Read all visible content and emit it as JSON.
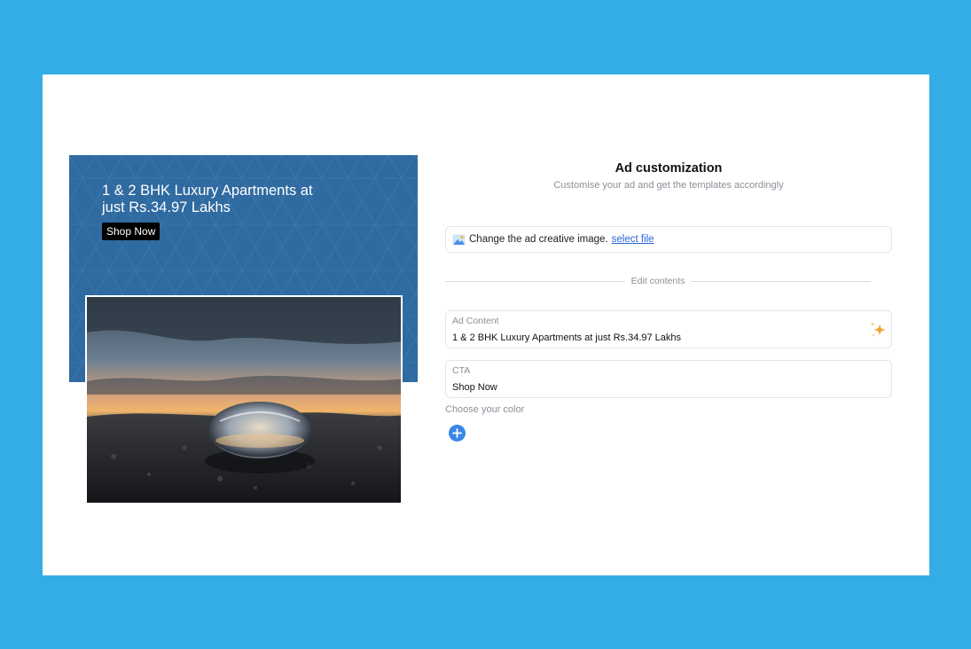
{
  "ad": {
    "headline": "1 & 2 BHK Luxury Apartments at just Rs.34.97 Lakhs",
    "cta_label": "Shop Now",
    "banner_color": "#2f6aa0"
  },
  "panel": {
    "title": "Ad customization",
    "subtitle": "Customise your ad and get the templates accordingly",
    "upload_text": "Change the ad creative image.",
    "upload_link": "select file",
    "divider_label": "Edit contents",
    "content_field": {
      "label": "Ad Content",
      "value": "1 & 2 BHK Luxury Apartments at just Rs.34.97 Lakhs"
    },
    "cta_field": {
      "label": "CTA",
      "value": "Shop Now"
    },
    "color_label": "Choose your color"
  },
  "icons": {
    "upload": "image-icon",
    "ai": "sparkle-icon",
    "add": "plus-icon"
  },
  "colors": {
    "background": "#34ade6",
    "accent": "#3a86e8",
    "sparkle": "#f0a630",
    "link": "#2864d8"
  }
}
